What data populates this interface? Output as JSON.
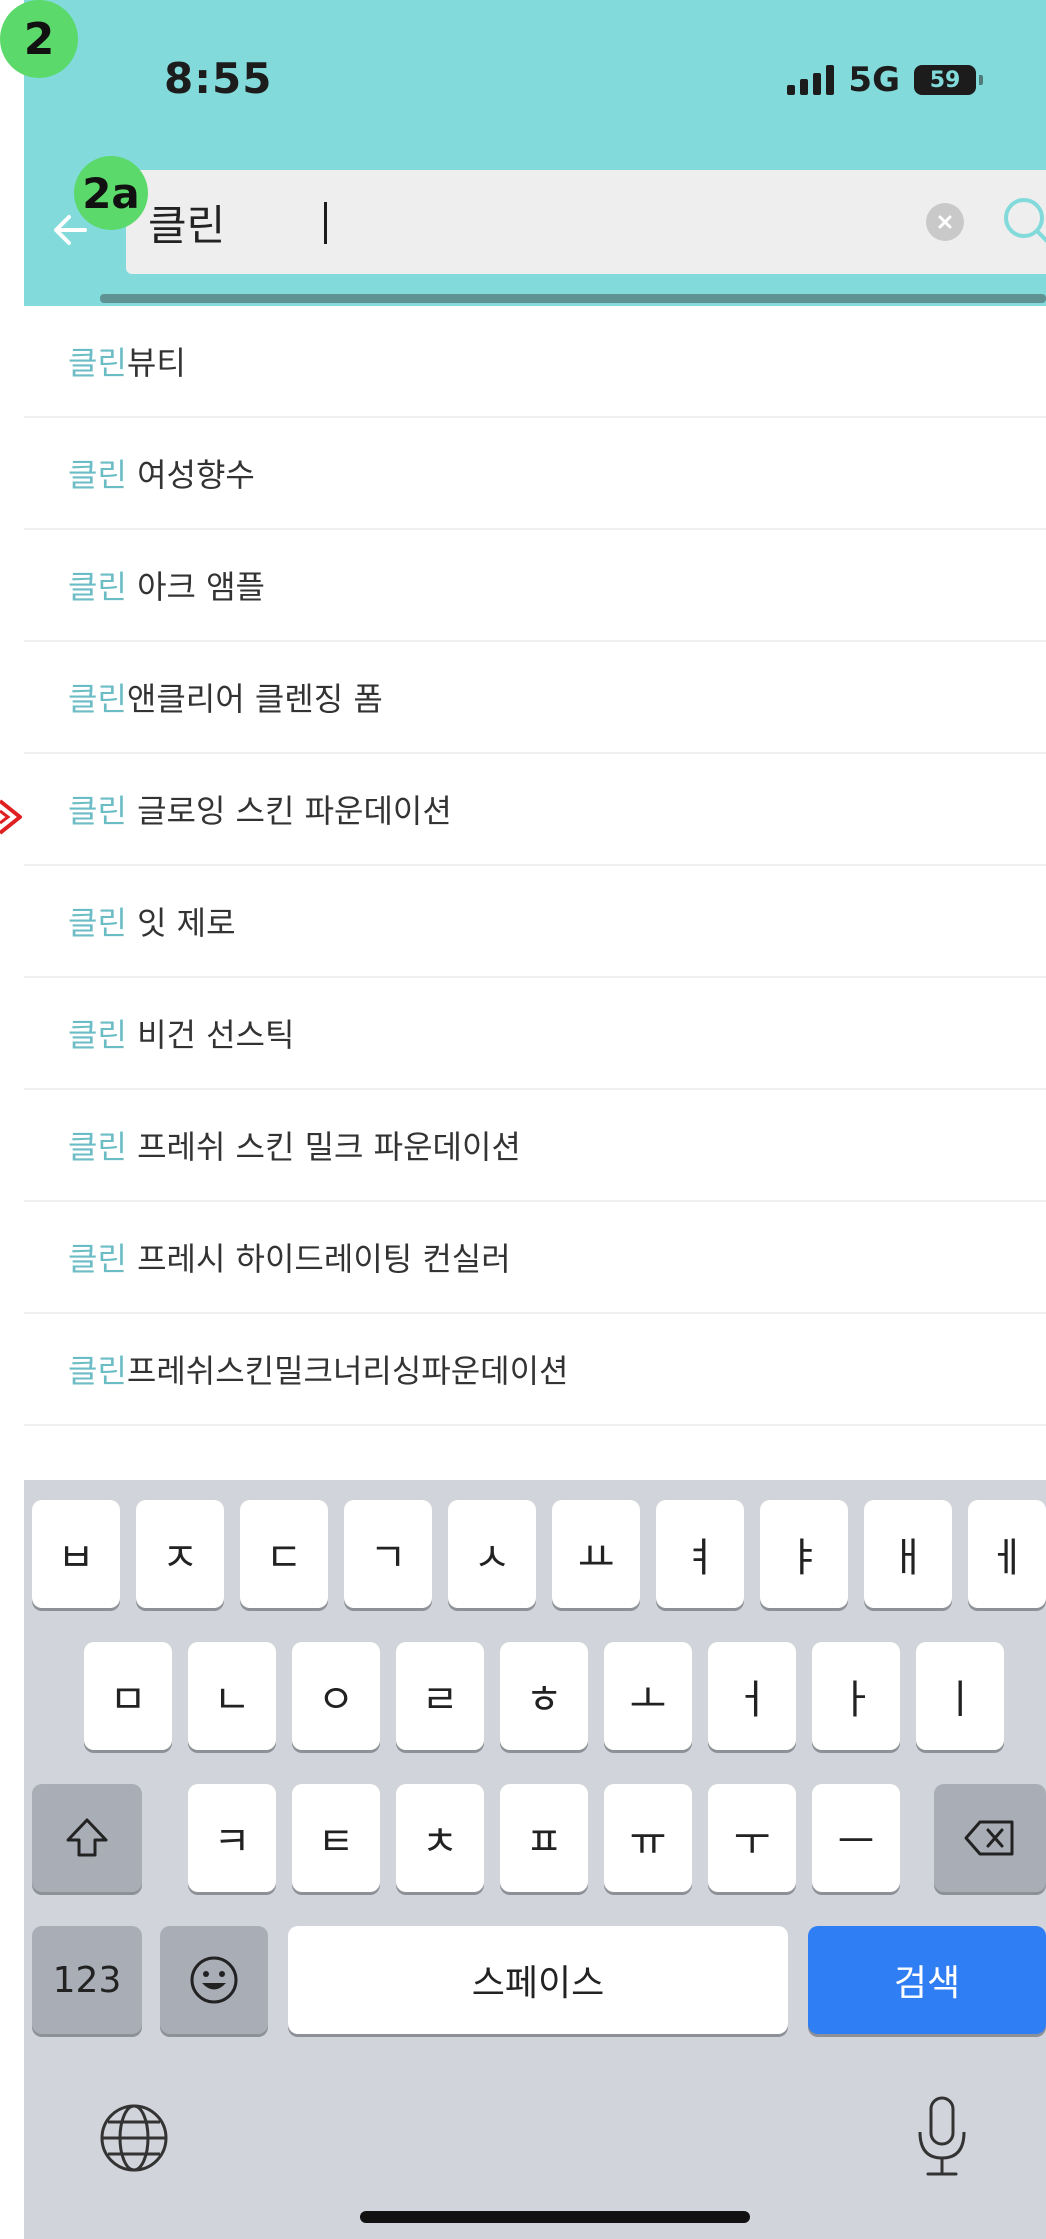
{
  "annotations": {
    "main_badge": "2",
    "search_badge": "2a"
  },
  "status_bar": {
    "time": "8:55",
    "network": "5G",
    "battery": "59"
  },
  "search": {
    "value": "클린"
  },
  "suggestions": [
    {
      "match": "클린",
      "rest": "뷰티"
    },
    {
      "match": "클린",
      "rest": " 여성향수"
    },
    {
      "match": "클린",
      "rest": " 아크 앰플"
    },
    {
      "match": "클린",
      "rest": "앤클리어 클렌징 폼"
    },
    {
      "match": "클린",
      "rest": " 글로잉 스킨 파운데이션"
    },
    {
      "match": "클린",
      "rest": " 잇 제로"
    },
    {
      "match": "클린",
      "rest": " 비건 선스틱"
    },
    {
      "match": "클린",
      "rest": " 프레쉬 스킨 밀크 파운데이션"
    },
    {
      "match": "클린",
      "rest": " 프레시 하이드레이팅 컨실러"
    },
    {
      "match": "클린",
      "rest": "프레쉬스킨밀크너리싱파운데이션"
    }
  ],
  "keyboard": {
    "row1": [
      "ㅂ",
      "ㅈ",
      "ㄷ",
      "ㄱ",
      "ㅅ",
      "ㅛ",
      "ㅕ",
      "ㅑ",
      "ㅐ",
      "ㅔ"
    ],
    "row2": [
      "ㅁ",
      "ㄴ",
      "ㅇ",
      "ㄹ",
      "ㅎ",
      "ㅗ",
      "ㅓ",
      "ㅏ",
      "ㅣ"
    ],
    "row3": [
      "ㅋ",
      "ㅌ",
      "ㅊ",
      "ㅍ",
      "ㅠ",
      "ㅜ",
      "ㅡ"
    ],
    "numbers_label": "123",
    "space_label": "스페이스",
    "search_label": "검색"
  },
  "icons": {
    "back": "arrow-left-icon",
    "clear": "clear-icon",
    "search": "search-icon",
    "shift": "shift-icon",
    "delete": "backspace-icon",
    "emoji": "emoji-icon",
    "globe": "globe-icon",
    "mic": "microphone-icon"
  },
  "colors": {
    "header": "#82dada",
    "highlight": "#6bbcc4",
    "search_key": "#2f7ef3",
    "badge": "#5bd96a",
    "annotation_arrow": "#e02020"
  }
}
